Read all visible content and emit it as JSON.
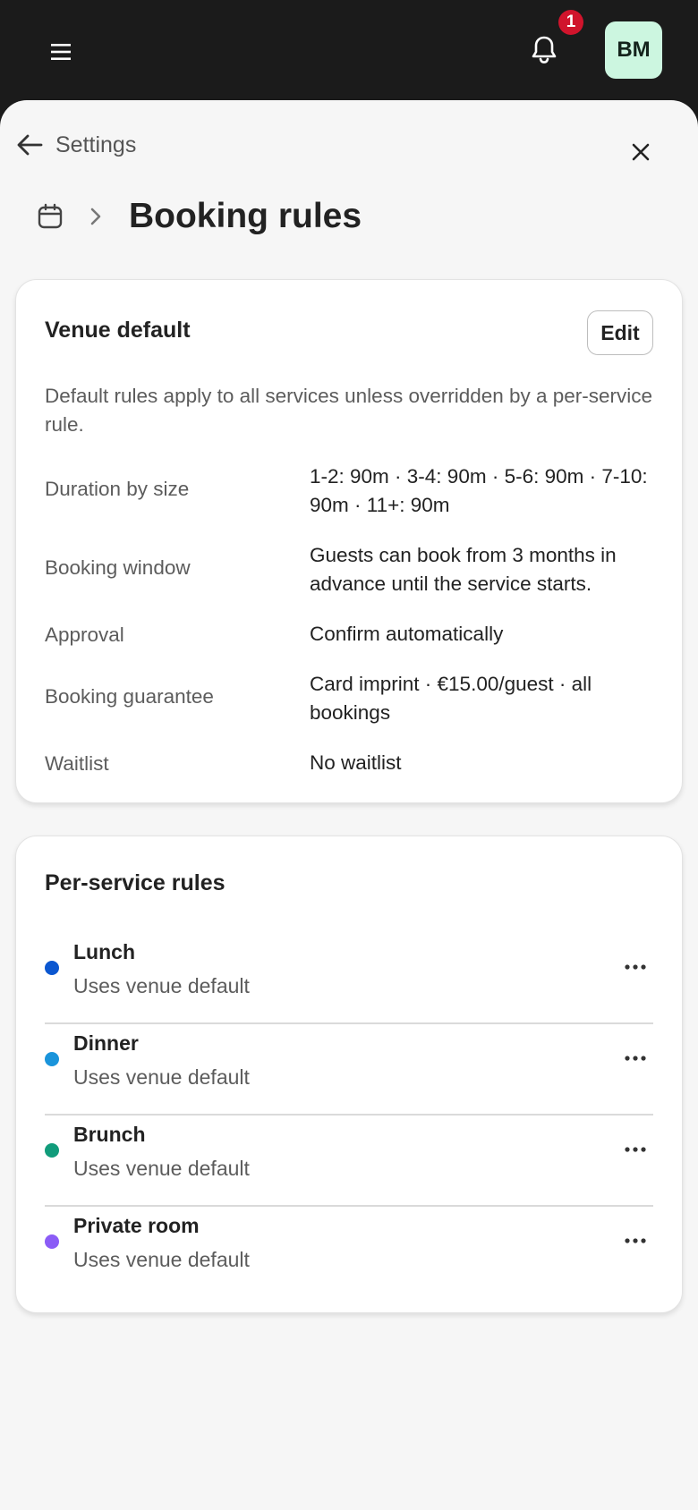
{
  "header": {
    "menu_icon": "hamburger-menu-icon",
    "notifications": {
      "icon": "bell-icon",
      "count": "1",
      "badge_color": "#d0142c"
    },
    "avatar": {
      "initials": "BM",
      "bg_color": "#ccf6e0"
    }
  },
  "nav": {
    "back_label": "Settings",
    "back_icon": "arrow-left-icon",
    "close_icon": "close-icon"
  },
  "breadcrumb": {
    "icon": "calendar-icon",
    "separator_icon": "chevron-right-icon",
    "title": "Booking rules"
  },
  "venue_default": {
    "title": "Venue default",
    "edit_label": "Edit",
    "description": "Default rules apply to all services unless overridden by a per-service rule.",
    "rules": [
      {
        "label": "Duration by size",
        "value": "1-2: 90m · 3-4: 90m · 5-6: 90m · 7-10: 90m · 11+: 90m"
      },
      {
        "label": "Booking window",
        "value": "Guests can book from 3 months in advance until the service starts."
      },
      {
        "label": "Approval",
        "value": "Confirm automatically"
      },
      {
        "label": "Booking guarantee",
        "value": "Card imprint · €15.00/guest · all bookings"
      },
      {
        "label": "Waitlist",
        "value": "No waitlist"
      }
    ]
  },
  "per_service": {
    "title": "Per-service rules",
    "items": [
      {
        "name": "Lunch",
        "status": "Uses venue default",
        "color": "#0b57d0",
        "menu_icon": "more-horizontal-icon"
      },
      {
        "name": "Dinner",
        "status": "Uses venue default",
        "color": "#1a94db",
        "menu_icon": "more-horizontal-icon"
      },
      {
        "name": "Brunch",
        "status": "Uses venue default",
        "color": "#119c7b",
        "menu_icon": "more-horizontal-icon"
      },
      {
        "name": "Private room",
        "status": "Uses venue default",
        "color": "#8b5cf6",
        "menu_icon": "more-horizontal-icon"
      }
    ]
  }
}
